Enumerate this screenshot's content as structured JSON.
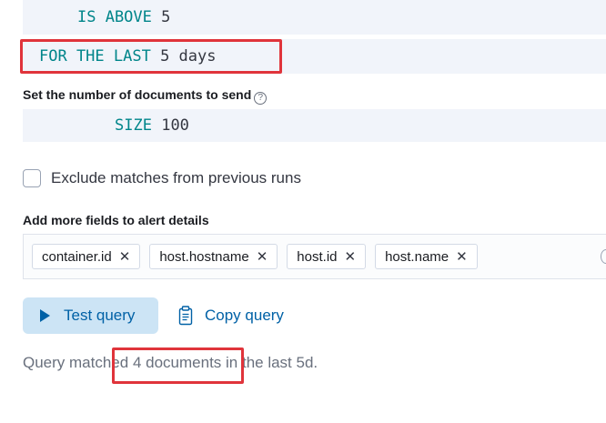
{
  "query": {
    "is_above": {
      "keyword": "IS ABOVE",
      "value": "5"
    },
    "for_the_last": {
      "keyword": "FOR THE LAST",
      "value": "5 days"
    },
    "size": {
      "keyword": "SIZE",
      "value": "100"
    }
  },
  "size_section": {
    "label": "Set the number of documents to send",
    "help_icon": "question-circle-icon"
  },
  "exclude": {
    "label": "Exclude matches from previous runs",
    "checked": false
  },
  "fields_section": {
    "label": "Add more fields to alert details",
    "chips": [
      {
        "label": "container.id"
      },
      {
        "label": "host.hostname"
      },
      {
        "label": "host.id"
      },
      {
        "label": "host.name"
      }
    ],
    "remove_symbol": "✕"
  },
  "buttons": {
    "test_query": "Test query",
    "copy_query": "Copy query"
  },
  "result": {
    "prefix": "Query matched ",
    "count": "4 documents",
    "suffix": " in the last 5d."
  },
  "colors": {
    "keyword": "#00858a",
    "accent": "#0061a6",
    "highlight": "#e0343b"
  }
}
